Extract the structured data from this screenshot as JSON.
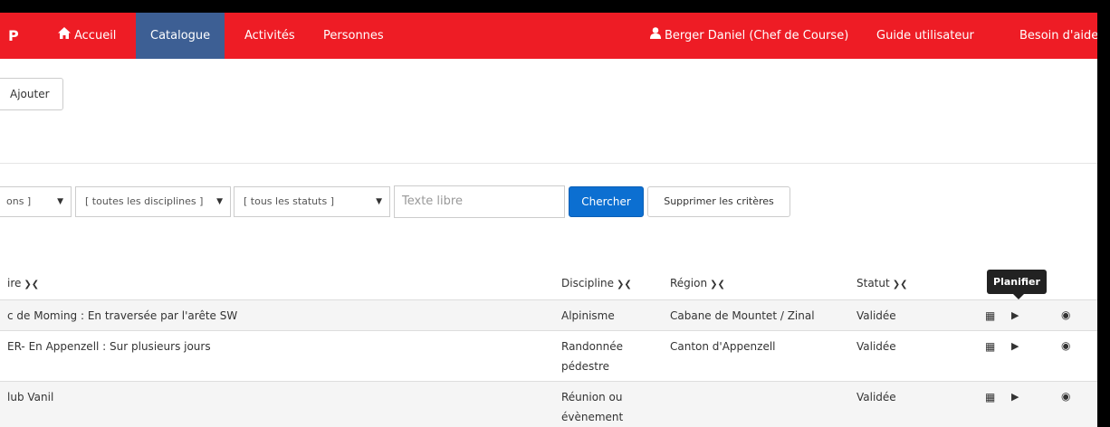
{
  "navbar": {
    "brand": "P",
    "items": [
      {
        "label": "Accueil"
      },
      {
        "label": "Catalogue"
      },
      {
        "label": "Activités"
      },
      {
        "label": "Personnes"
      }
    ],
    "user": "Berger Daniel (Chef de Course)",
    "guide": "Guide utilisateur",
    "help": "Besoin d'aide ?",
    "accent_color": "#ee1c25",
    "active_color": "#3d5f94"
  },
  "toolbar": {
    "add_label": "Ajouter"
  },
  "filters": {
    "select1_value": "ons ]",
    "select2_value": "[ toutes les disciplines ]",
    "select3_value": "[ tous les statuts ]",
    "search_placeholder": "Texte libre",
    "search_button": "Chercher",
    "clear_button": "Supprimer les critères"
  },
  "table": {
    "headers": {
      "title": "ire",
      "discipline": "Discipline",
      "region": "Région",
      "statut": "Statut"
    },
    "rows": [
      {
        "title": "c de Moming : En traversée par l'arête SW",
        "discipline": "Alpinisme",
        "region": "Cabane de Mountet / Zinal",
        "statut": "Validée"
      },
      {
        "title": "ER- En Appenzell : Sur plusieurs jours",
        "discipline": "Randonnée pédestre",
        "region": "Canton d'Appenzell",
        "statut": "Validée"
      },
      {
        "title": "lub Vanil",
        "discipline": "Réunion ou évènement",
        "region": "",
        "statut": "Validée"
      }
    ]
  },
  "tooltip": {
    "label": "Planifier"
  }
}
